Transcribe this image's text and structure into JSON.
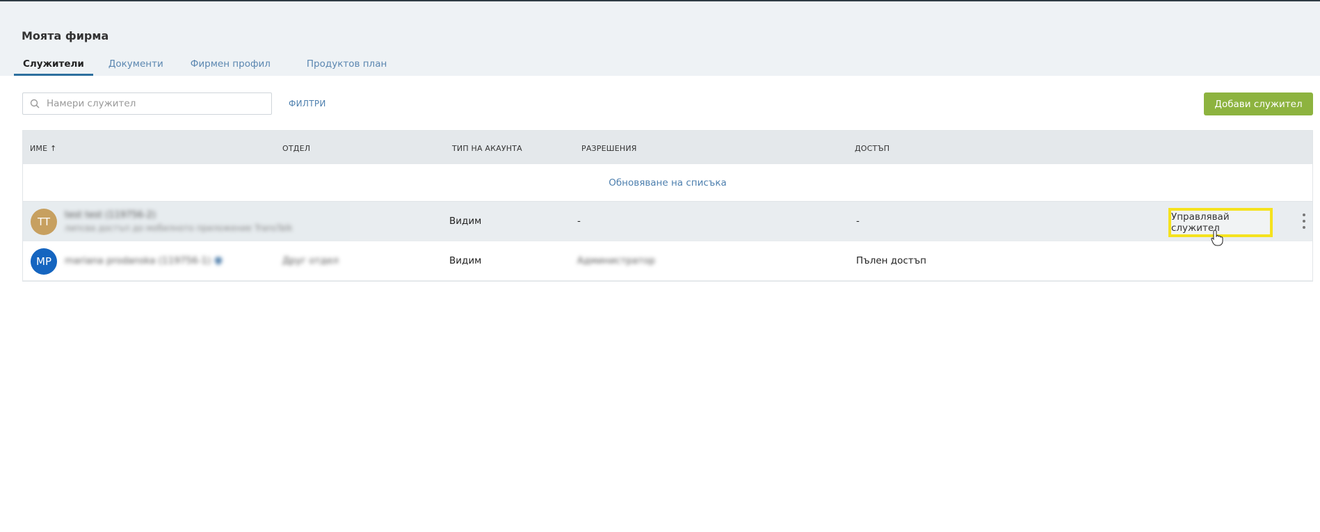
{
  "page": {
    "title": "Моята фирма"
  },
  "tabs": [
    {
      "label": "Служители",
      "active": true
    },
    {
      "label": "Документи",
      "active": false
    },
    {
      "label": "Фирмен профил",
      "active": false
    },
    {
      "label": "Продуктов план",
      "active": false
    }
  ],
  "toolbar": {
    "search_placeholder": "Намери служител",
    "filters_label": "ФИЛТРИ",
    "add_label": "Добави служител"
  },
  "table": {
    "columns": [
      "ИМЕ ↑",
      "ОТДЕЛ",
      "ТИП НА АКАУНТА",
      "РАЗРЕШЕНИЯ",
      "ДОСТЪП"
    ],
    "refresh_label": "Обновяване на списъка",
    "rows": [
      {
        "initials": "TT",
        "avatar_color": "#c7a060",
        "name": "test test (119756-2)",
        "subtitle": "липсва достъп до мобилното приложение TransTalk",
        "department": "",
        "account_type": "Видим",
        "permissions": "-",
        "access": "-",
        "manage_label": "Управлявай служител"
      },
      {
        "initials": "MP",
        "avatar_color": "#1565c0",
        "name": "mariana prodanska (119756-1)",
        "department": "Друг отдел",
        "account_type": "Видим",
        "permissions": "Администратор",
        "access": "Пълен достъп"
      }
    ]
  },
  "colors": {
    "accent_green": "#8db33f",
    "link_blue": "#4d7fae",
    "highlight_yellow": "#f5e21e"
  }
}
